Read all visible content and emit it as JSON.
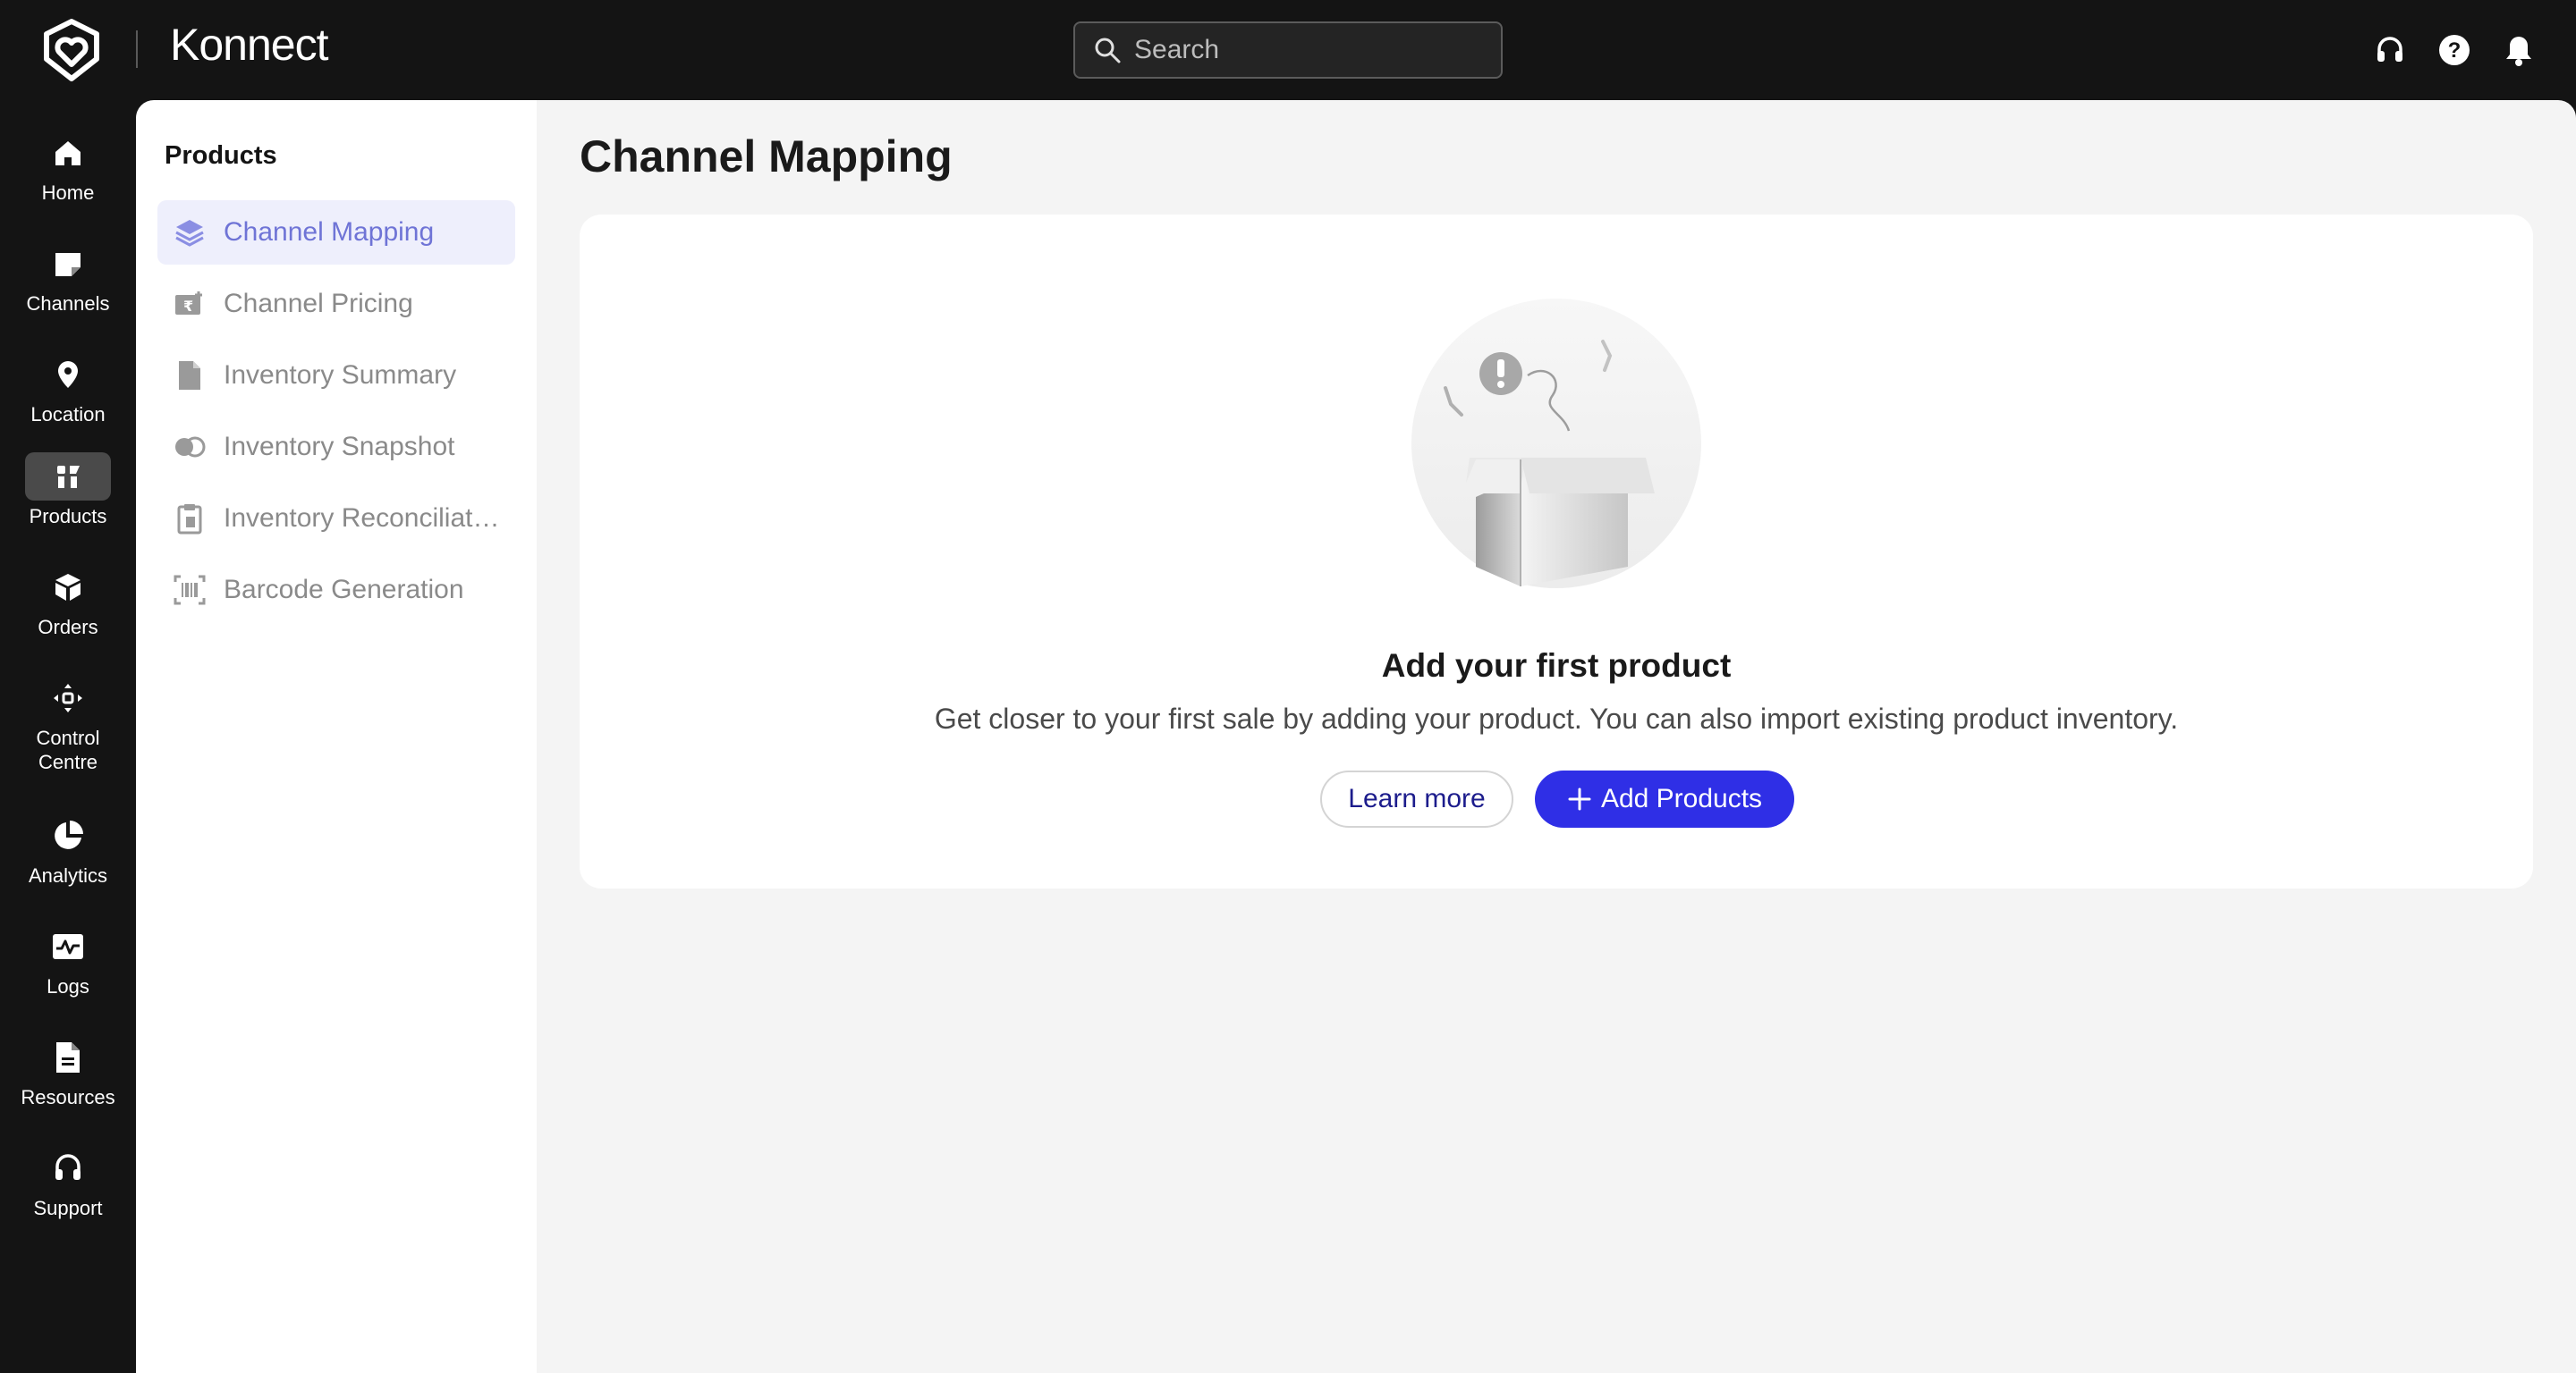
{
  "app": {
    "name": "Konnect"
  },
  "search": {
    "placeholder": "Search"
  },
  "topbar_icons": [
    "headset-icon",
    "help-icon",
    "bell-icon"
  ],
  "nav": {
    "items": [
      {
        "label": "Home",
        "icon": "home-icon"
      },
      {
        "label": "Channels",
        "icon": "channels-icon"
      },
      {
        "label": "Location",
        "icon": "location-pin-icon"
      },
      {
        "label": "Products",
        "icon": "products-icon",
        "active": true
      },
      {
        "label": "Orders",
        "icon": "box-icon"
      },
      {
        "label": "Control Centre",
        "icon": "control-centre-icon"
      },
      {
        "label": "Analytics",
        "icon": "pie-chart-icon"
      },
      {
        "label": "Logs",
        "icon": "activity-icon"
      },
      {
        "label": "Resources",
        "icon": "document-icon"
      },
      {
        "label": "Support",
        "icon": "headset-icon"
      }
    ]
  },
  "subnav": {
    "title": "Products",
    "items": [
      {
        "label": "Channel Mapping",
        "icon": "layers-icon",
        "active": true
      },
      {
        "label": "Channel Pricing",
        "icon": "price-tag-icon"
      },
      {
        "label": "Inventory Summary",
        "icon": "file-icon"
      },
      {
        "label": "Inventory Snapshot",
        "icon": "snapshot-icon"
      },
      {
        "label": "Inventory Reconciliati...",
        "icon": "clipboard-icon"
      },
      {
        "label": "Barcode Generation",
        "icon": "barcode-icon"
      }
    ]
  },
  "main": {
    "title": "Channel Mapping",
    "empty_state": {
      "title": "Add your first product",
      "subtitle": "Get closer to your first sale by adding your product. You can also import existing product inventory.",
      "learn_more_label": "Learn more",
      "add_products_label": "Add Products"
    }
  },
  "colors": {
    "topbar_bg": "#141414",
    "accent": "#2f2fe6",
    "active_subitem_bg": "#eeeffc",
    "active_subitem_text": "#6f74d6",
    "main_bg": "#f4f4f4"
  }
}
